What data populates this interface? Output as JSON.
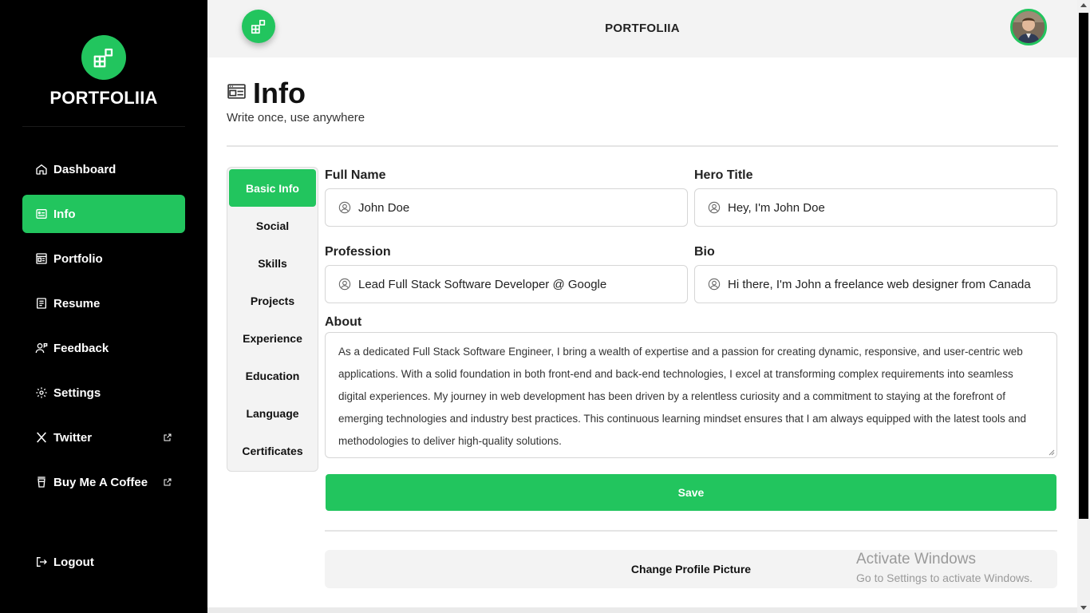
{
  "brand": {
    "name": "PORTFOLIIA",
    "accent": "#22c55e"
  },
  "sidebar": {
    "items": [
      {
        "label": "Dashboard",
        "icon": "home-icon",
        "active": false,
        "external": false
      },
      {
        "label": "Info",
        "icon": "info-card-icon",
        "active": true,
        "external": false
      },
      {
        "label": "Portfolio",
        "icon": "portfolio-icon",
        "active": false,
        "external": false
      },
      {
        "label": "Resume",
        "icon": "resume-icon",
        "active": false,
        "external": false
      },
      {
        "label": "Feedback",
        "icon": "feedback-icon",
        "active": false,
        "external": false
      },
      {
        "label": "Settings",
        "icon": "gear-icon",
        "active": false,
        "external": false
      },
      {
        "label": "Twitter",
        "icon": "x-logo-icon",
        "active": false,
        "external": true
      },
      {
        "label": "Buy Me A Coffee",
        "icon": "coffee-cup-icon",
        "active": false,
        "external": true
      }
    ],
    "logout_label": "Logout"
  },
  "topbar": {
    "title": "PORTFOLIIA"
  },
  "page": {
    "title": "Info",
    "subtitle": "Write once, use anywhere"
  },
  "tabs": [
    "Basic Info",
    "Social",
    "Skills",
    "Projects",
    "Experience",
    "Education",
    "Language",
    "Certificates"
  ],
  "form": {
    "full_name": {
      "label": "Full Name",
      "value": "John Doe"
    },
    "hero_title": {
      "label": "Hero Title",
      "value": "Hey, I'm John Doe"
    },
    "profession": {
      "label": "Profession",
      "value": "Lead Full Stack Software Developer @ Google"
    },
    "bio": {
      "label": "Bio",
      "value": "Hi there, I'm John a freelance web designer from Canada"
    },
    "about": {
      "label": "About",
      "value": "As a dedicated Full Stack Software Engineer, I bring a wealth of expertise and a passion for creating dynamic, responsive, and user-centric web applications. With a solid foundation in both front-end and back-end technologies, I excel at transforming complex requirements into seamless digital experiences. My journey in web development has been driven by a relentless curiosity and a commitment to staying at the forefront of emerging technologies and industry best practices. This continuous learning mindset ensures that I am always equipped with the latest tools and methodologies to deliver high-quality solutions."
    },
    "save_label": "Save",
    "change_picture_label": "Change Profile Picture"
  },
  "watermark": {
    "title": "Activate Windows",
    "subtitle": "Go to Settings to activate Windows."
  }
}
